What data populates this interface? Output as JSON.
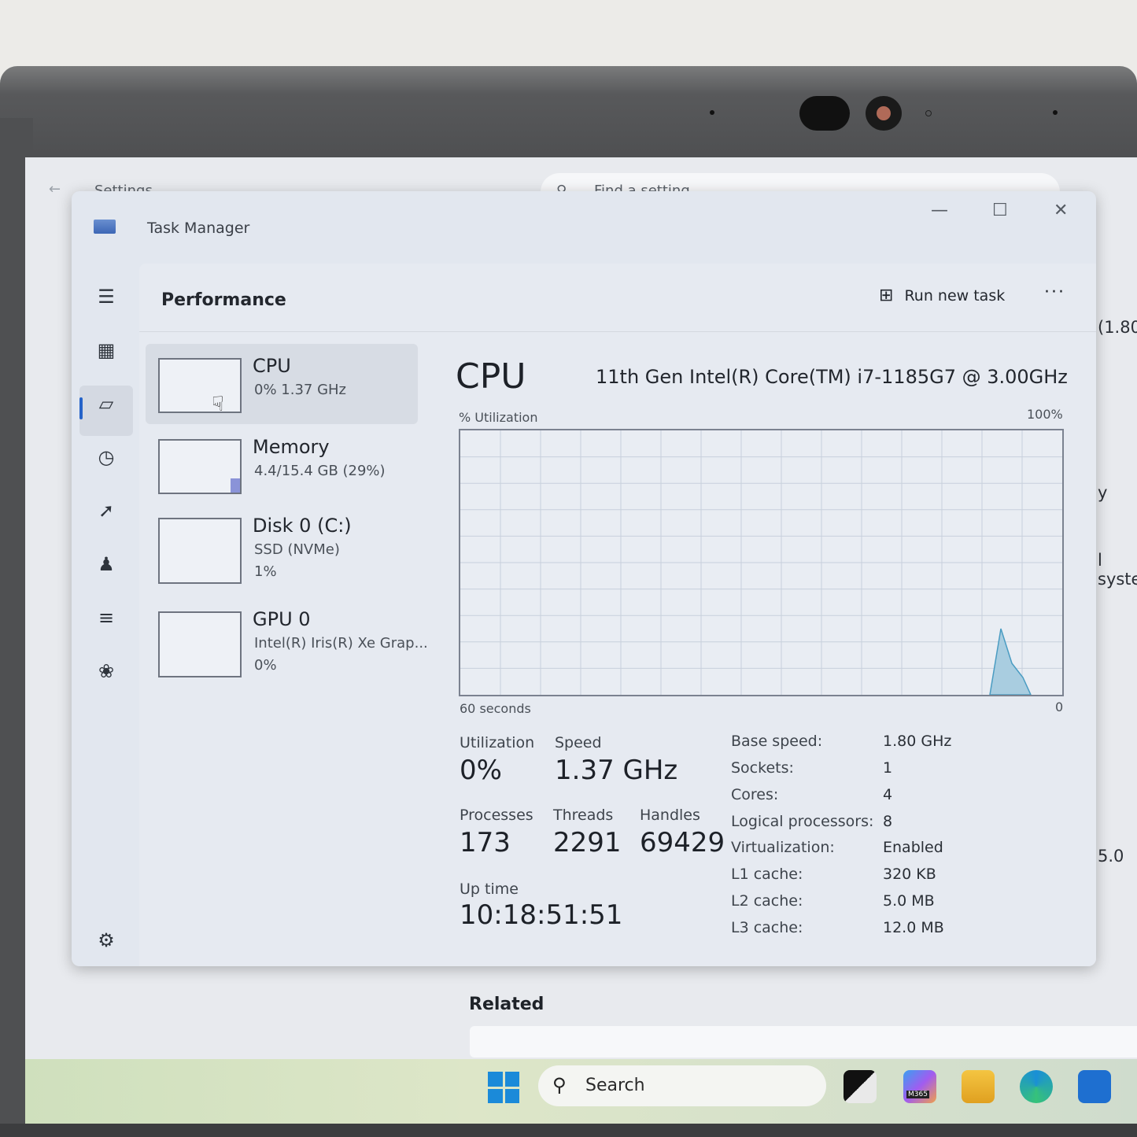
{
  "settings_bg": {
    "title": "Settings",
    "search_placeholder": "Find a setting",
    "right_fragments": [
      "(1.80",
      "y",
      "l syste",
      "5.0"
    ],
    "related": "Related"
  },
  "taskbar": {
    "search_label": "Search",
    "apps": [
      "task-view-icon",
      "m365-copilot-icon",
      "file-explorer-icon",
      "edge-icon",
      "store-icon"
    ],
    "m365_label": "M365"
  },
  "task_manager": {
    "title": "Task Manager",
    "page_title": "Performance",
    "run_new_task": "Run new task",
    "more": "···",
    "resources": [
      {
        "name": "CPU",
        "sub": "0%  1.37 GHz",
        "sub2": ""
      },
      {
        "name": "Memory",
        "sub": "4.4/15.4 GB (29%)",
        "sub2": ""
      },
      {
        "name": "Disk 0 (C:)",
        "sub": "SSD (NVMe)",
        "sub2": "1%"
      },
      {
        "name": "GPU 0",
        "sub": "Intel(R) Iris(R) Xe Grap...",
        "sub2": "0%"
      }
    ],
    "detail": {
      "heading": "CPU",
      "model": "11th Gen Intel(R) Core(TM) i7-1185G7 @ 3.00GHz",
      "y_label": "% Utilization",
      "y_max": "100%",
      "x_left": "60 seconds",
      "x_right": "0",
      "utilization_label": "Utilization",
      "utilization": "0%",
      "speed_label": "Speed",
      "speed": "1.37 GHz",
      "processes_label": "Processes",
      "processes": "173",
      "threads_label": "Threads",
      "threads": "2291",
      "handles_label": "Handles",
      "handles": "69429",
      "uptime_label": "Up time",
      "uptime": "10:18:51:51",
      "specs": [
        {
          "k": "Base speed:",
          "v": "1.80 GHz"
        },
        {
          "k": "Sockets:",
          "v": "1"
        },
        {
          "k": "Cores:",
          "v": "4"
        },
        {
          "k": "Logical processors:",
          "v": "8"
        },
        {
          "k": "Virtualization:",
          "v": "Enabled"
        },
        {
          "k": "L1 cache:",
          "v": "320 KB"
        },
        {
          "k": "L2 cache:",
          "v": "5.0 MB"
        },
        {
          "k": "L3 cache:",
          "v": "12.0 MB"
        }
      ]
    },
    "graph": {
      "seconds": 60,
      "series_percent": [
        0,
        0,
        0,
        0,
        0,
        0,
        0,
        0,
        0,
        0,
        0,
        0,
        0,
        0,
        0,
        0,
        0,
        0,
        0,
        0,
        0,
        0,
        0,
        0,
        0,
        0,
        0,
        0,
        0,
        0,
        0,
        0,
        0,
        0,
        0,
        0,
        0,
        0,
        0,
        0,
        0,
        0,
        0,
        0,
        0,
        0,
        0,
        0,
        0,
        0,
        0,
        0,
        0,
        0,
        0,
        0,
        0,
        0,
        0,
        0,
        0,
        0,
        0,
        0,
        0,
        0,
        0,
        0,
        0,
        0,
        0,
        0,
        0,
        0,
        0,
        0,
        0,
        0,
        0,
        0,
        0,
        0,
        0,
        0,
        0,
        0,
        0,
        0,
        0,
        0,
        0,
        0,
        0,
        0,
        0,
        0,
        0,
        0,
        0,
        0
      ],
      "peak_percent": 25,
      "fill_color": "#a9cde0",
      "line_color": "#4a9cc2"
    }
  }
}
